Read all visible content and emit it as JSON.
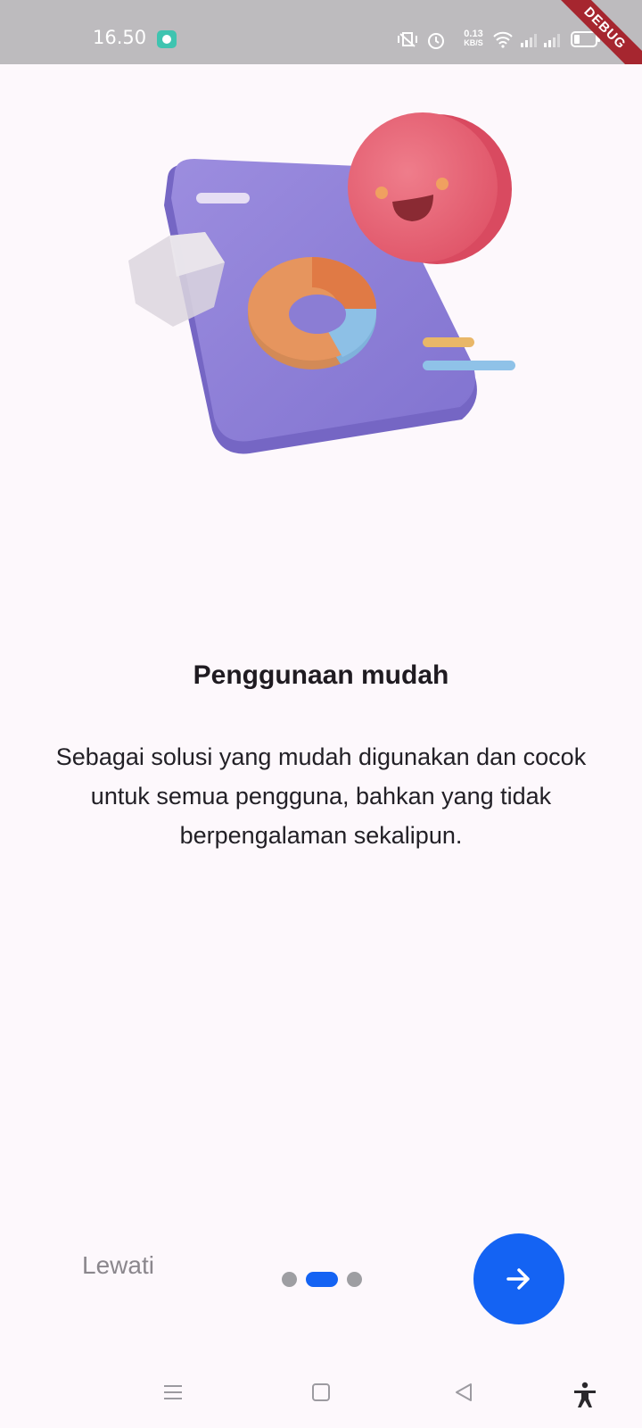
{
  "status_bar": {
    "time": "16.50",
    "network_speed_value": "0.13",
    "network_speed_unit": "KB/S",
    "icons": [
      "app-notification-icon",
      "vibrate-off-icon",
      "alarm-icon",
      "wifi-icon",
      "signal-icon",
      "signal-icon",
      "battery-icon"
    ]
  },
  "debug_banner": "DEBUG",
  "onboarding": {
    "title": "Penggunaan mudah",
    "description": "Sebagai solusi yang mudah digunakan dan cocok untuk semua pengguna, bahkan yang tidak berpengalaman sekalipun.",
    "illustration": "3d-dashboard-illustration"
  },
  "controls": {
    "skip_label": "Lewati",
    "page_indicator": {
      "total": 3,
      "current": 2
    },
    "next_icon": "arrow-right-icon",
    "accent_color": "#1463f3"
  },
  "nav_bar": {
    "icons": [
      "menu-icon",
      "home-icon",
      "back-icon",
      "accessibility-icon"
    ]
  }
}
